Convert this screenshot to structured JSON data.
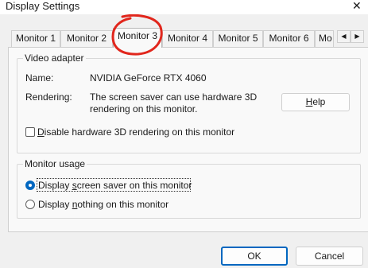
{
  "window": {
    "title": "Display Settings",
    "close_glyph": "✕"
  },
  "tabs": {
    "items": [
      "Monitor 1",
      "Monitor 2",
      "Monitor 3",
      "Monitor 4",
      "Monitor 5",
      "Monitor 6",
      "Mo"
    ],
    "active": "Monitor 3",
    "scroll_left_glyph": "◀",
    "scroll_right_glyph": "▶"
  },
  "annotation": {
    "color": "#e1261c",
    "shape": "hand-drawn circle around active tab"
  },
  "video_adapter": {
    "title": "Video adapter",
    "name_label": "Name:",
    "name_value": "NVIDIA GeForce RTX 4060",
    "rendering_label": "Rendering:",
    "rendering_line1": "The screen saver can use hardware 3D",
    "rendering_line2": "rendering on this monitor.",
    "help_button": {
      "accel": "H",
      "rest": "elp"
    },
    "disable_checkbox": {
      "accel": "D",
      "rest": "isable hardware 3D rendering on this monitor",
      "checked": false
    }
  },
  "monitor_usage": {
    "title": "Monitor usage",
    "option_screensaver": {
      "before": "Display ",
      "accel": "s",
      "after": "creen saver on this monitor",
      "selected": true
    },
    "option_nothing": {
      "before": "Display ",
      "accel": "n",
      "after": "othing on this monitor",
      "selected": false
    }
  },
  "footer": {
    "ok_label": "OK",
    "cancel_label": "Cancel"
  },
  "colors": {
    "accent": "#0067c0",
    "annotation_red": "#e1261c"
  }
}
